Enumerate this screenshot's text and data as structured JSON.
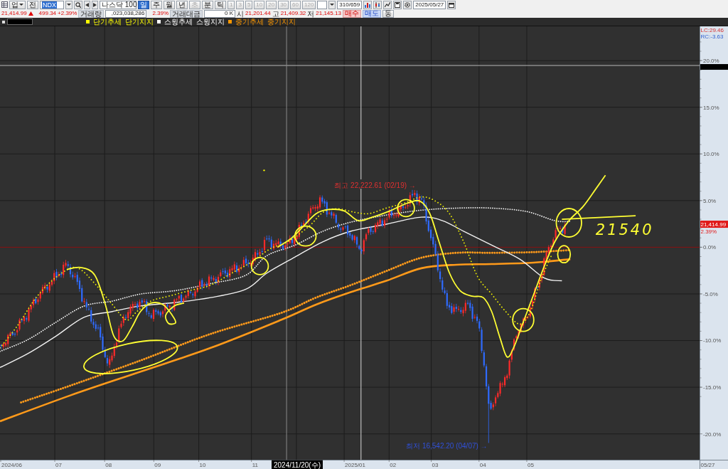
{
  "toolbar": {
    "market_type": "업",
    "scope": "전",
    "code": "NDX",
    "name": "나스닥 100",
    "periods": [
      {
        "label": "일",
        "selected": true,
        "disabled": false
      },
      {
        "label": "주",
        "selected": false,
        "disabled": false
      },
      {
        "label": "월",
        "selected": false,
        "disabled": false
      },
      {
        "label": "년",
        "selected": false,
        "disabled": false
      },
      {
        "label": "초",
        "selected": false,
        "disabled": true
      },
      {
        "label": "분",
        "selected": false,
        "disabled": false
      },
      {
        "label": "틱",
        "selected": false,
        "disabled": false
      }
    ],
    "intervals": [
      {
        "label": "1",
        "disabled": true
      },
      {
        "label": "3",
        "disabled": true
      },
      {
        "label": "5",
        "disabled": true
      },
      {
        "label": "10",
        "disabled": true
      },
      {
        "label": "20",
        "disabled": true
      },
      {
        "label": "30",
        "disabled": true
      },
      {
        "label": "60",
        "disabled": true
      },
      {
        "label": "120",
        "disabled": true
      }
    ],
    "count": "310/659",
    "date": "2025/05/27"
  },
  "quote": {
    "price": "21,414.99",
    "rising": true,
    "change": "499.34",
    "change_rate": "+2.39%",
    "volume_label": "거래량",
    "volume": ",023,038,286",
    "volume_rate": "2.39%",
    "turnover_label": "거래대금",
    "turnover": "0 K",
    "open_label": "시",
    "open": "21,201.44",
    "high_label": "고",
    "high": "21,409.32",
    "low_label": "저",
    "low": "21,145.13",
    "buttons": [
      {
        "label": "매수",
        "kind": "buy"
      },
      {
        "label": "매도",
        "kind": "sell"
      },
      {
        "label": "동",
        "kind": "plain"
      }
    ]
  },
  "chart": {
    "legend": [
      {
        "color": "#ffff00",
        "labels": [
          "단기추세",
          "단기지지"
        ]
      },
      {
        "color": "#ffffff",
        "labels": [
          "스윙추세",
          "스윙지지"
        ]
      },
      {
        "color": "#ff9900",
        "labels": [
          "중기추세",
          "중기지지"
        ]
      }
    ],
    "high_note": "최고 22,222.61 (02/19) →",
    "low_note": "최저 16,542.20 (04/07) →",
    "handwritten_note": "21540",
    "right_axis": {
      "left_change": "LC:29.46",
      "right_change": "RC:-3.63",
      "ticks": [
        "20.0%",
        "15.0%",
        "10.0%",
        "5.0%",
        "0.0%",
        "-5.0%",
        "-10.0%",
        "-15.0%",
        "-20.0%"
      ],
      "price_tag": "21,414.99",
      "price_rate": "2.39%"
    },
    "time_axis": {
      "labels": [
        "2024/06",
        "07",
        "08",
        "09",
        "10",
        "11",
        "2025/01",
        "02",
        "03",
        "04",
        "05"
      ],
      "cursor_label": "2024/11/20(수)",
      "last_label": "05/27"
    }
  }
}
